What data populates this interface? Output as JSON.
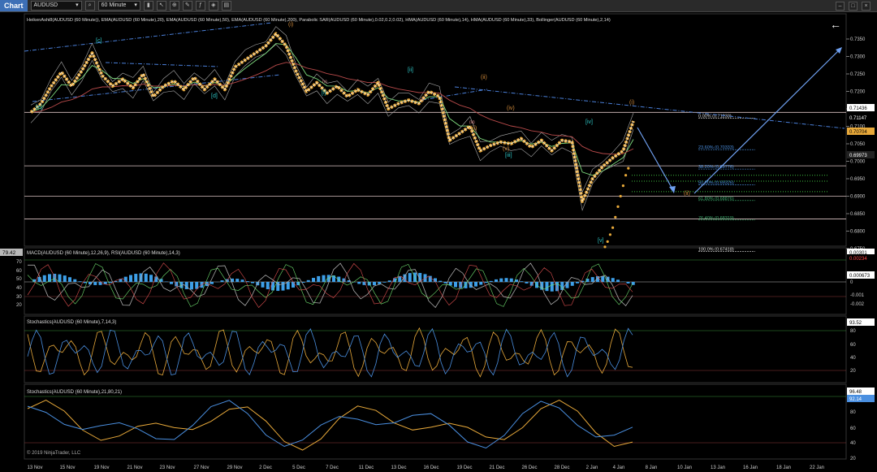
{
  "toolbar": {
    "title": "Chart",
    "instrument": "AUDUSD",
    "interval": "60 Minute"
  },
  "panel_titles": {
    "price": "HeikenAshi8(AUDUSD (60 Minute)), EMA(AUDUSD (60 Minute),20), EMA(AUDUSD (60 Minute),50), EMA(AUDUSD (60 Minute),200), Parabolic SAR(AUDUSD (60 Minute),0.02,0.2,0.02), HMA(AUDUSD (60 Minute),14), HMA(AUDUSD (60 Minute),33), Bollinger(AUDUSD (60 Minute),2,14)",
    "macd": "MACD(AUDUSD (60 Minute),12,26,9), RSI(AUDUSD (60 Minute),14,3)",
    "stoch1": "Stochastics(AUDUSD (60 Minute),7,14,3)",
    "stoch2": "Stochastics(AUDUSD (60 Minute),21,80,21)"
  },
  "copyright": "© 2019 NinjaTrader, LLC",
  "colors": {
    "background": "#000000",
    "price_line": "#e8a93a",
    "ema_fast": "#7fdc7f",
    "ema_slow": "#b84a4a",
    "trend": "#4a7fd8",
    "wave_blue": "#2ec4c4",
    "wave_orange": "#d08a3a"
  },
  "chart_data": [
    {
      "type": "line",
      "panel": "price",
      "x_labels": [
        "13 Nov",
        "15 Nov",
        "19 Nov",
        "21 Nov",
        "23 Nov",
        "27 Nov",
        "29 Nov",
        "2 Dec",
        "5 Dec",
        "7 Dec",
        "11 Dec",
        "13 Dec",
        "16 Dec",
        "19 Dec",
        "21 Dec",
        "26 Dec",
        "28 Dec",
        "2 Jan",
        "4 Jan",
        "8 Jan",
        "10 Jan",
        "13 Jan",
        "16 Jan",
        "18 Jan",
        "22 Jan"
      ],
      "ylim": [
        0.673,
        0.7375
      ],
      "y_ticks": [
        "0.7350",
        "0.7300",
        "0.7250",
        "0.7200",
        "0.7150",
        "0.7100",
        "0.7050",
        "0.7000",
        "0.6950",
        "0.6900",
        "0.6850",
        "0.6800",
        "0.6750"
      ],
      "price_series": [
        [
          0,
          0.714
        ],
        [
          1,
          0.7165
        ],
        [
          2,
          0.7215
        ],
        [
          3,
          0.7255
        ],
        [
          4,
          0.7215
        ],
        [
          5,
          0.726
        ],
        [
          6,
          0.731
        ],
        [
          7,
          0.7245
        ],
        [
          8,
          0.7215
        ],
        [
          9,
          0.7235
        ],
        [
          10,
          0.721
        ],
        [
          11,
          0.725
        ],
        [
          12,
          0.7185
        ],
        [
          13,
          0.7215
        ],
        [
          14,
          0.723
        ],
        [
          15,
          0.7205
        ],
        [
          16,
          0.724
        ],
        [
          17,
          0.7205
        ],
        [
          18,
          0.7235
        ],
        [
          19,
          0.7205
        ],
        [
          20,
          0.727
        ],
        [
          21,
          0.729
        ],
        [
          22,
          0.731
        ],
        [
          23,
          0.733
        ],
        [
          24,
          0.7365
        ],
        [
          25,
          0.733
        ],
        [
          26,
          0.7255
        ],
        [
          27,
          0.72
        ],
        [
          28,
          0.7225
        ],
        [
          29,
          0.7195
        ],
        [
          30,
          0.7215
        ],
        [
          31,
          0.7185
        ],
        [
          32,
          0.7205
        ],
        [
          33,
          0.719
        ],
        [
          34,
          0.7225
        ],
        [
          35,
          0.715
        ],
        [
          36,
          0.7165
        ],
        [
          37,
          0.7175
        ],
        [
          38,
          0.7165
        ],
        [
          39,
          0.72
        ],
        [
          40,
          0.7185
        ],
        [
          41,
          0.706
        ],
        [
          42,
          0.708
        ],
        [
          43,
          0.71
        ],
        [
          44,
          0.703
        ],
        [
          45,
          0.7045
        ],
        [
          46,
          0.7055
        ],
        [
          47,
          0.705
        ],
        [
          48,
          0.7065
        ],
        [
          49,
          0.704
        ],
        [
          50,
          0.706
        ],
        [
          51,
          0.703
        ],
        [
          52,
          0.706
        ],
        [
          53,
          0.7055
        ],
        [
          54,
          0.6885
        ],
        [
          55,
          0.695
        ],
        [
          56,
          0.6985
        ],
        [
          57,
          0.701
        ],
        [
          58,
          0.703
        ],
        [
          59,
          0.7115
        ]
      ],
      "horizontal_levels": [
        0.714,
        0.6987,
        0.69,
        0.6835
      ],
      "sar_values": [
        0.6755,
        0.677,
        0.679,
        0.681,
        0.684,
        0.687,
        0.69,
        0.693,
        0.696,
        0.698
      ],
      "fib_levels": [
        {
          "label": "0.00% (0.71233)",
          "value": 0.71233
        },
        {
          "label": "23.60% (0.70333)",
          "value": 0.70333
        },
        {
          "label": "38.20% (0.69776)",
          "value": 0.69776
        },
        {
          "label": "50.00% (0.69326)",
          "value": 0.69326
        },
        {
          "label": "61.80% (0.68876)",
          "value": 0.68876
        },
        {
          "label": "76.40% (0.68319)",
          "value": 0.68319
        },
        {
          "label": "100.0% (0.67418)",
          "value": 0.67418
        }
      ],
      "price_badges": [
        "0.71436",
        "0.71147",
        "0.70704",
        "0.69973"
      ],
      "wave_labels_blue": [
        "[e]",
        "[c]",
        "[d]",
        "[i]",
        "[ii]",
        "[iii]",
        "[iv]",
        "[v]"
      ],
      "wave_labels_orange": [
        "(i)",
        "(ii)",
        "(iii)",
        "(iv)",
        "(v)",
        "(i)",
        "(ii)"
      ],
      "wave_labels_small": [
        "(v)",
        "(iii)",
        "(i)"
      ]
    },
    {
      "type": "line",
      "panel": "macd",
      "ylim": [
        -0.003,
        0.0035
      ],
      "left_ticks": [
        "70",
        "60",
        "50",
        "40",
        "30",
        "20"
      ],
      "right_ticks": [
        "0.002",
        "0",
        "-0.001",
        "-0.002"
      ],
      "rsi_badge": "79.42",
      "right_badges": [
        "0.00301",
        "0.00234",
        "0.000673"
      ]
    },
    {
      "type": "line",
      "panel": "stoch1",
      "ylim": [
        0,
        100
      ],
      "y_ticks": [
        "80",
        "60",
        "40",
        "20"
      ],
      "badge": "93.52"
    },
    {
      "type": "line",
      "panel": "stoch2",
      "ylim": [
        0,
        100
      ],
      "y_ticks": [
        "80",
        "60",
        "40",
        "20"
      ],
      "badges": [
        "96.48",
        "92.14"
      ]
    }
  ]
}
